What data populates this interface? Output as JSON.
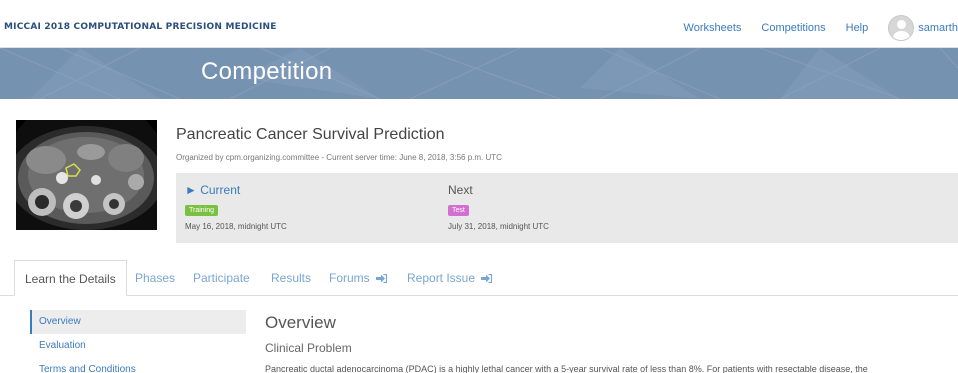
{
  "nav": {
    "brand": "MICCAI 2018 COMPUTATIONAL PRECISION MEDICINE",
    "links": [
      "Worksheets",
      "Competitions",
      "Help"
    ],
    "user": "samarth"
  },
  "banner": {
    "title": "Competition"
  },
  "competition": {
    "title": "Pancreatic Cancer Survival Prediction",
    "organizer_line": "Organized by cpm.organizing.committee - Current server time: June 8, 2018, 3:56 p.m. UTC",
    "image_icon": "ct-scan-image"
  },
  "phases": {
    "current": {
      "heading": "► Current",
      "badge": "Training",
      "date": "May 16, 2018, midnight UTC"
    },
    "next": {
      "heading": "Next",
      "badge": "Test",
      "date": "July 31, 2018, midnight UTC"
    }
  },
  "tabs": [
    {
      "label": "Learn the Details"
    },
    {
      "label": "Phases"
    },
    {
      "label": "Participate"
    },
    {
      "label": "Results"
    },
    {
      "label": "Forums"
    },
    {
      "label": "Report Issue"
    }
  ],
  "sidebar": {
    "items": [
      {
        "label": "Overview"
      },
      {
        "label": "Evaluation"
      },
      {
        "label": "Terms and Conditions"
      }
    ]
  },
  "main": {
    "heading": "Overview",
    "subheading": "Clinical Problem",
    "paragraph": "Pancreatic ductal adenocarcinoma (PDAC) is a highly lethal cancer with a 5-year survival rate of less than 8%. For patients with resectable disease, the"
  },
  "colors": {
    "brand": "#2a4f7e",
    "link": "#3b7bbf",
    "banner": "#7592b1",
    "badge_training": "#7ac142",
    "badge_test": "#d36fd0"
  }
}
